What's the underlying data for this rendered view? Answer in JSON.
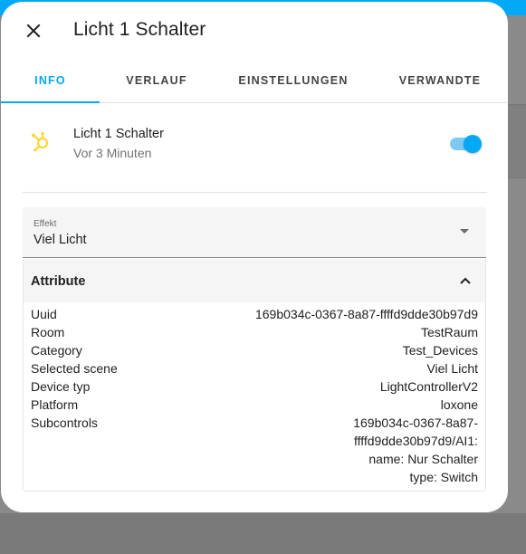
{
  "dialog": {
    "title": "Licht 1 Schalter",
    "close_icon": "close-icon"
  },
  "tabs": [
    {
      "label": "INFO",
      "active": true
    },
    {
      "label": "VERLAUF",
      "active": false
    },
    {
      "label": "EINSTELLUNGEN",
      "active": false
    },
    {
      "label": "VERWANDTE",
      "active": false
    }
  ],
  "entity": {
    "icon": "hubspot-icon",
    "name": "Licht 1 Schalter",
    "last_changed": "Vor 3 Minuten",
    "state_on": true
  },
  "effect_select": {
    "label": "Effekt",
    "value": "Viel Licht"
  },
  "attributes": {
    "title": "Attribute",
    "expanded": true,
    "rows": [
      {
        "key": "Uuid",
        "value": "169b034c-0367-8a87-ffffd9dde30b97d9"
      },
      {
        "key": "Room",
        "value": "TestRaum"
      },
      {
        "key": "Category",
        "value": "Test_Devices"
      },
      {
        "key": "Selected scene",
        "value": "Viel Licht"
      },
      {
        "key": "Device typ",
        "value": "LightControllerV2"
      },
      {
        "key": "Platform",
        "value": "loxone"
      }
    ],
    "subcontrols": {
      "key": "Subcontrols",
      "lines": [
        "169b034c-0367-8a87-",
        "ffffd9dde30b97d9/AI1:",
        "name: Nur Schalter",
        "type: Switch"
      ]
    }
  },
  "colors": {
    "accent": "#03a9f4",
    "icon_yellow": "#fdd835"
  }
}
